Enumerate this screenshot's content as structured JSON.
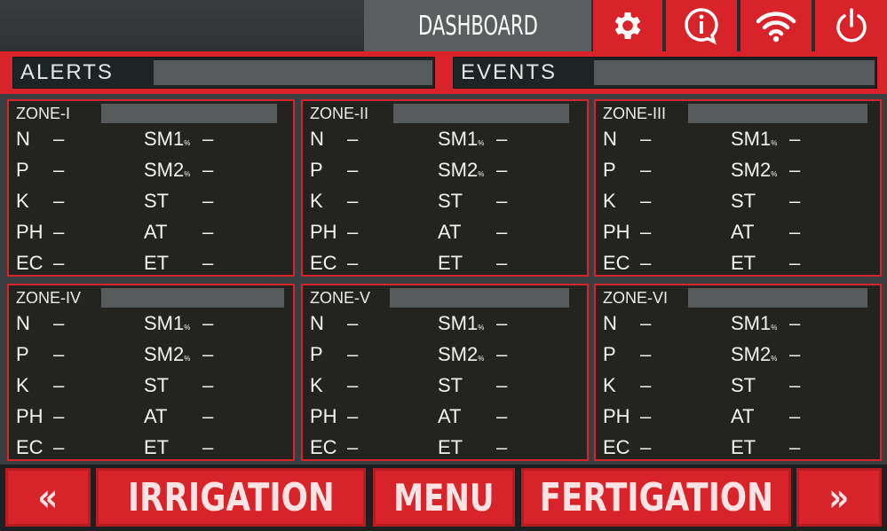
{
  "header": {
    "title": "DASHBOARD",
    "icons": [
      "gear-icon",
      "info-icon",
      "wifi-icon",
      "power-icon"
    ]
  },
  "status": {
    "alerts_label": "ALERTS",
    "alerts_value": "",
    "events_label": "EVENTS",
    "events_value": ""
  },
  "zones": [
    {
      "name": "ZONE-I",
      "status": "",
      "N": "–",
      "P": "–",
      "K": "–",
      "PH": "–",
      "EC": "–",
      "SM1": "–",
      "SM2": "–",
      "ST": "–",
      "AT": "–",
      "ET": "–"
    },
    {
      "name": "ZONE-II",
      "status": "",
      "N": "–",
      "P": "–",
      "K": "–",
      "PH": "–",
      "EC": "–",
      "SM1": "–",
      "SM2": "–",
      "ST": "–",
      "AT": "–",
      "ET": "–"
    },
    {
      "name": "ZONE-III",
      "status": "",
      "N": "–",
      "P": "–",
      "K": "–",
      "PH": "–",
      "EC": "–",
      "SM1": "–",
      "SM2": "–",
      "ST": "–",
      "AT": "–",
      "ET": "–"
    },
    {
      "name": "ZONE-IV",
      "status": "",
      "N": "–",
      "P": "–",
      "K": "–",
      "PH": "–",
      "EC": "–",
      "SM1": "–",
      "SM2": "–",
      "ST": "–",
      "AT": "–",
      "ET": "–"
    },
    {
      "name": "ZONE-V",
      "status": "",
      "N": "–",
      "P": "–",
      "K": "–",
      "PH": "–",
      "EC": "–",
      "SM1": "–",
      "SM2": "–",
      "ST": "–",
      "AT": "–",
      "ET": "–"
    },
    {
      "name": "ZONE-VI",
      "status": "",
      "N": "–",
      "P": "–",
      "K": "–",
      "PH": "–",
      "EC": "–",
      "SM1": "–",
      "SM2": "–",
      "ST": "–",
      "AT": "–",
      "ET": "–"
    }
  ],
  "labels": {
    "N": "N",
    "P": "P",
    "K": "K",
    "PH": "PH",
    "EC": "EC",
    "SM1": "SM1",
    "SM2": "SM2",
    "percent": "%",
    "ST": "ST",
    "AT": "AT",
    "ET": "ET"
  },
  "footer": {
    "prev": "«",
    "irrigation": "IRRIGATION",
    "menu": "MENU",
    "fertigation": "FERTIGATION",
    "next": "»"
  },
  "colors": {
    "accent": "#d8232a",
    "panel": "#232420",
    "header_title_bg": "#5b5e5e"
  }
}
